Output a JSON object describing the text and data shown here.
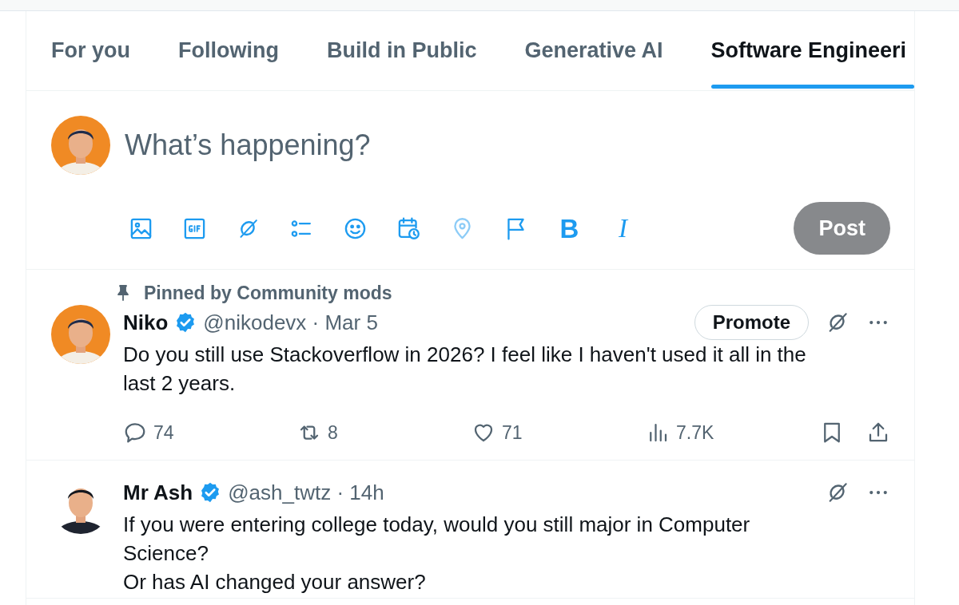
{
  "tabs": [
    {
      "label": "For you",
      "selected": false
    },
    {
      "label": "Following",
      "selected": false
    },
    {
      "label": "Build in Public",
      "selected": false
    },
    {
      "label": "Generative AI",
      "selected": false
    },
    {
      "label": "Software Engineeri",
      "selected": true
    }
  ],
  "composer": {
    "placeholder": "What’s happening?",
    "format_buttons": [
      "B",
      "I"
    ],
    "post_button": {
      "label": "Post",
      "disabled": true
    }
  },
  "posts": [
    {
      "pinned_label": "Pinned by Community mods",
      "name": "Niko",
      "verified": true,
      "byline": "@nikodevx · Mar 5",
      "promote": "Promote",
      "text": "Do you still use Stackoverflow in 2026? I feel like I haven't used it all in the last 2 years.",
      "stats": {
        "replies": "74",
        "reposts": "8",
        "likes": "71",
        "views": "7.7K"
      }
    },
    {
      "name": "Mr Ash",
      "verified": true,
      "byline": "@ash_twtz · 14h",
      "text": "If you were entering college today, would you still major in Computer Science?\nOr has AI changed your answer?"
    }
  ]
}
